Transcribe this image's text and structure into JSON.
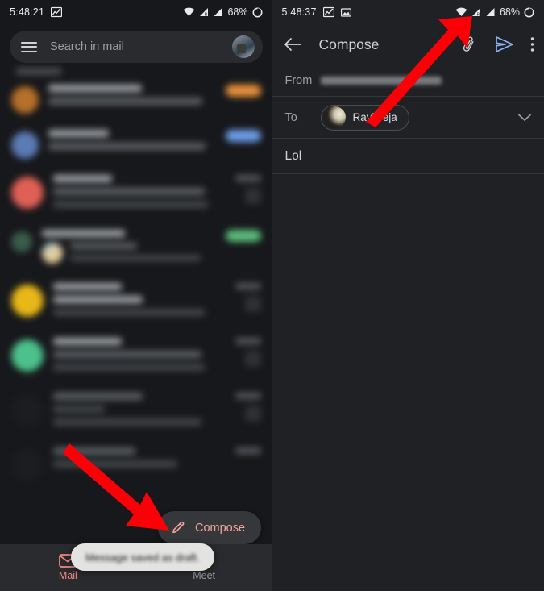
{
  "left": {
    "statusbar": {
      "time": "5:48:21",
      "battery_pct": "68%",
      "icons": [
        "chart-image-icon",
        "wifi-icon",
        "signal-roaming-icon",
        "signal-icon",
        "battery-circle-icon"
      ]
    },
    "search": {
      "placeholder": "Search in mail",
      "menu_icon": "hamburger-menu-icon",
      "avatar": "account-avatar"
    },
    "list": {
      "section_label": "",
      "rows": [
        {
          "avatar_color": "#b5702a",
          "chip_color": "#e8913c",
          "has_chip": true,
          "has_attach": false,
          "lines": 2
        },
        {
          "avatar_color": "#5b7bb4",
          "chip_color": "#6d9eeb",
          "has_chip": true,
          "has_attach": false,
          "lines": 2
        },
        {
          "avatar_color": "#e06055",
          "chip_color": "",
          "has_chip": false,
          "has_attach": true,
          "lines": 3
        },
        {
          "avatar_color": "#3a5d4a",
          "chip_color": "#5bbd7a",
          "has_chip": true,
          "has_attach": false,
          "lines": 2
        },
        {
          "avatar_color": "#e8b818",
          "chip_color": "",
          "has_chip": false,
          "has_attach": true,
          "lines": 3
        },
        {
          "avatar_color": "#4cc18c",
          "chip_color": "",
          "has_chip": false,
          "has_attach": true,
          "lines": 3
        },
        {
          "avatar_color": "#1c1d20",
          "chip_color": "",
          "has_chip": false,
          "has_attach": true,
          "lines": 3
        },
        {
          "avatar_color": "#1c1d20",
          "chip_color": "",
          "has_chip": false,
          "has_attach": false,
          "lines": 2
        }
      ]
    },
    "fab": {
      "label": "Compose",
      "icon": "pencil-icon",
      "color": "#f2a599"
    },
    "toast": {
      "message": "Message saved as draft."
    },
    "bottomnav": {
      "items": [
        {
          "label": "Mail",
          "icon": "mail-icon",
          "active": true
        },
        {
          "label": "Meet",
          "icon": "video-camera-icon",
          "active": false
        }
      ],
      "active_color": "#f28b82",
      "idle_color": "#9aa0a6"
    }
  },
  "right": {
    "statusbar": {
      "time": "5:48:37",
      "battery_pct": "68%",
      "icons": [
        "chart-image-icon",
        "image-icon",
        "wifi-icon",
        "signal-roaming-icon",
        "signal-icon",
        "battery-circle-icon"
      ]
    },
    "header": {
      "back_icon": "back-arrow-icon",
      "title": "Compose",
      "attach_icon": "paperclip-icon",
      "send_icon": "send-icon",
      "more_icon": "overflow-menu-icon",
      "send_color": "#8ab4f8"
    },
    "fields": {
      "from_label": "From",
      "from_value": "",
      "to_label": "To",
      "recipient_name": "Ravi Teja",
      "expand_icon": "chevron-down-icon",
      "subject_value": "Lol",
      "body_value": ""
    }
  },
  "annotations": {
    "arrow_color": "#fb0007",
    "arrows": [
      {
        "name": "arrow-to-attach-icon",
        "target": "paperclip-icon"
      },
      {
        "name": "arrow-to-compose-fab",
        "target": "compose-fab"
      }
    ]
  }
}
